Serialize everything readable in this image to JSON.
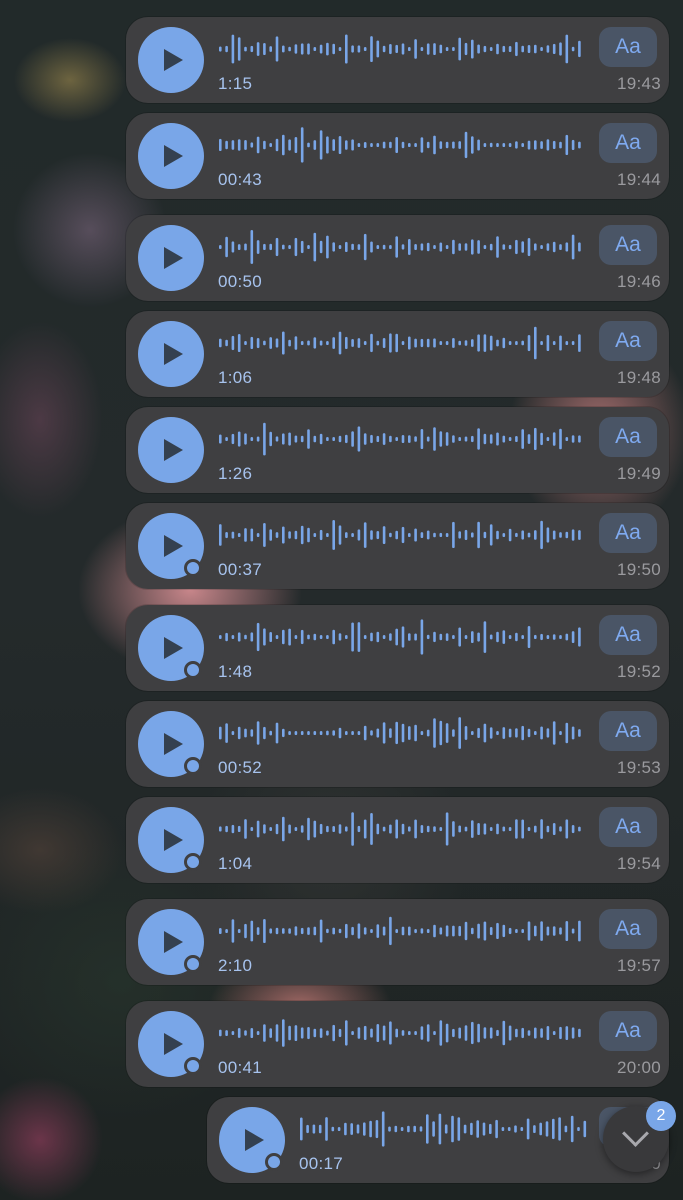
{
  "theme": {
    "accent": "#79a6e8",
    "bubble": "#3f3f41",
    "duration_text": "#a7c3ee",
    "time_text": "#9a9a9e"
  },
  "messages": [
    {
      "duration": "1:15",
      "time": "19:43",
      "transcribe_label": "Aa",
      "unplayed": false
    },
    {
      "duration": "00:43",
      "time": "19:44",
      "transcribe_label": "Aa",
      "unplayed": false
    },
    {
      "duration": "00:50",
      "time": "19:46",
      "transcribe_label": "Aa",
      "unplayed": false
    },
    {
      "duration": "1:06",
      "time": "19:48",
      "transcribe_label": "Aa",
      "unplayed": false
    },
    {
      "duration": "1:26",
      "time": "19:49",
      "transcribe_label": "Aa",
      "unplayed": false
    },
    {
      "duration": "00:37",
      "time": "19:50",
      "transcribe_label": "Aa",
      "unplayed": true
    },
    {
      "duration": "1:48",
      "time": "19:52",
      "transcribe_label": "Aa",
      "unplayed": true
    },
    {
      "duration": "00:52",
      "time": "19:53",
      "transcribe_label": "Aa",
      "unplayed": true
    },
    {
      "duration": "1:04",
      "time": "19:54",
      "transcribe_label": "Aa",
      "unplayed": true
    },
    {
      "duration": "2:10",
      "time": "19:57",
      "transcribe_label": "Aa",
      "unplayed": true
    },
    {
      "duration": "00:41",
      "time": "20:00",
      "transcribe_label": "Aa",
      "unplayed": true
    },
    {
      "duration": "00:17",
      "time": "20",
      "transcribe_label": "Aa",
      "unplayed": true
    }
  ],
  "scroll_to_bottom": {
    "icon": "chevron-down-icon",
    "badge_count": "2"
  }
}
